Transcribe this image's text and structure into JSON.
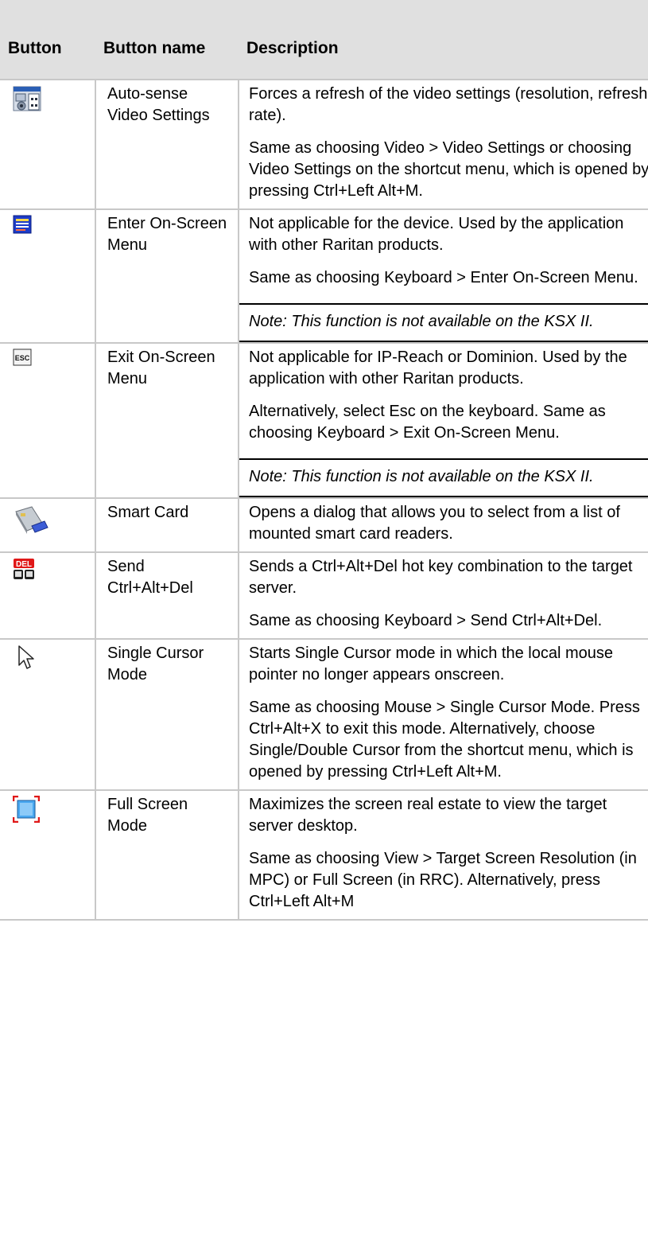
{
  "headers": {
    "button": "Button",
    "button_name": "Button name",
    "description": "Description"
  },
  "rows": [
    {
      "icon": "video-settings-icon",
      "name": "Auto-sense Video Settings",
      "desc": [
        "Forces a refresh of the video settings (resolution, refresh rate).",
        "Same as choosing Video > Video Settings or choosing Video Settings on the shortcut menu, which is opened by pressing Ctrl+Left Alt+M."
      ]
    },
    {
      "icon": "on-screen-menu-icon",
      "name": "Enter On-Screen Menu",
      "desc": [
        "Not applicable for the device. Used by the application with other Raritan products.",
        "Same as choosing Keyboard > Enter On-Screen Menu."
      ],
      "note": "Note: This function is not available on the KSX II."
    },
    {
      "icon": "esc-key-icon",
      "icon_text": "ESC",
      "name": "Exit On-Screen Menu",
      "desc": [
        "Not applicable for IP-Reach or Dominion. Used by the application with other Raritan products.",
        "Alternatively, select Esc on the keyboard. Same as choosing Keyboard > Exit On-Screen Menu."
      ],
      "note": "Note: This function is not available on the KSX II."
    },
    {
      "icon": "smart-card-icon",
      "name": "Smart Card",
      "desc": [
        "Opens a dialog that allows you to select from a list of mounted smart card readers."
      ]
    },
    {
      "icon": "ctrl-alt-del-icon",
      "icon_text": "DEL",
      "name": "Send Ctrl+Alt+Del",
      "desc": [
        "Sends a Ctrl+Alt+Del hot key combination to the target server.",
        "Same as choosing Keyboard > Send Ctrl+Alt+Del."
      ]
    },
    {
      "icon": "mouse-cursor-icon",
      "name": "Single Cursor Mode",
      "desc": [
        "Starts Single Cursor mode in which the local mouse pointer no longer appears onscreen.",
        "Same as choosing Mouse > Single Cursor Mode. Press Ctrl+Alt+X to exit this mode. Alternatively, choose Single/Double Cursor from the shortcut menu, which is opened by pressing Ctrl+Left Alt+M."
      ]
    },
    {
      "icon": "full-screen-icon",
      "name": "Full Screen Mode",
      "desc": [
        "Maximizes the screen real estate to view the target server desktop.",
        "Same as choosing View > Target Screen Resolution (in MPC) or Full Screen (in RRC). Alternatively, press Ctrl+Left Alt+M"
      ]
    }
  ]
}
